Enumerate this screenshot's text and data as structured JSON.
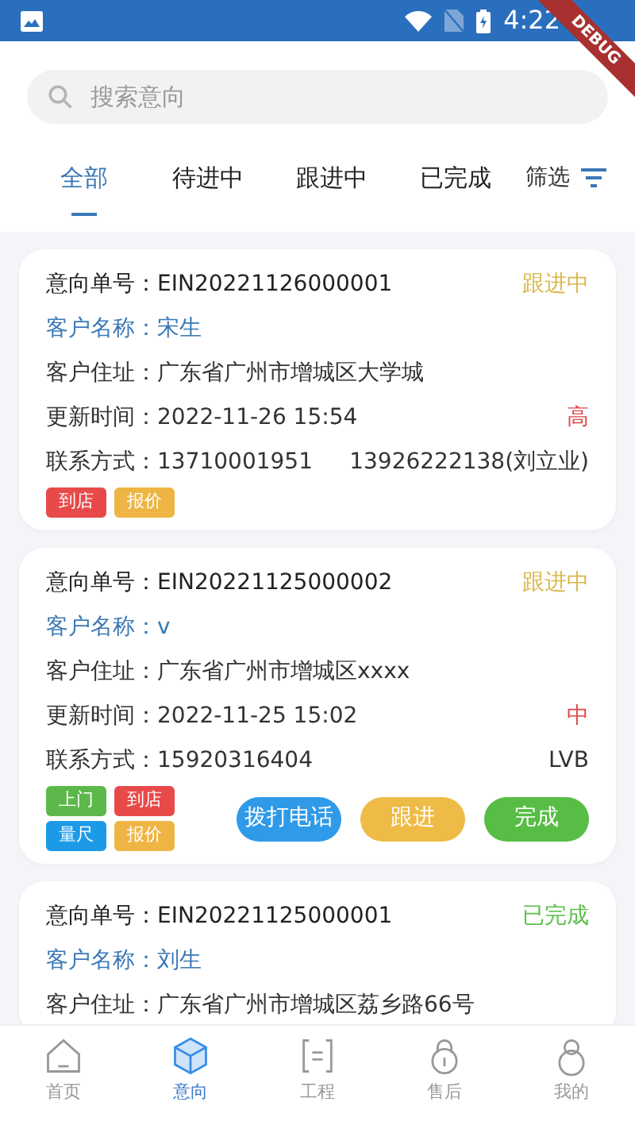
{
  "status_bar": {
    "time": "4:22"
  },
  "debug_banner": "DEBUG",
  "search": {
    "placeholder": "搜索意向"
  },
  "tabs": [
    {
      "label": "全部",
      "selected": true
    },
    {
      "label": "待进中",
      "selected": false
    },
    {
      "label": "跟进中",
      "selected": false
    },
    {
      "label": "已完成",
      "selected": false
    }
  ],
  "filter": {
    "label": "筛选"
  },
  "cards": [
    {
      "order_label": "意向单号：",
      "order_no": "EIN20221126000001",
      "status": {
        "text": "跟进中",
        "color": "#d9b94e"
      },
      "name_label": "客户名称：",
      "name": "宋生",
      "address_label": "客户住址：",
      "address": "广东省广州市增城区大学城",
      "time_label": "更新时间：",
      "time": "2022-11-26 15:54",
      "priority": {
        "text": "高",
        "color": "#e04848"
      },
      "contact_label": "联系方式：",
      "phone": "13710001951",
      "contact_2": "13926222138(刘立业)",
      "tags": [
        {
          "text": "到店",
          "color": "#e84a4a"
        },
        {
          "text": "报价",
          "color": "#efb544"
        }
      ]
    },
    {
      "order_label": "意向单号：",
      "order_no": "EIN20221125000002",
      "status": {
        "text": "跟进中",
        "color": "#d9b94e"
      },
      "name_label": "客户名称：",
      "name": "v",
      "address_label": "客户住址：",
      "address": "广东省广州市增城区xxxx",
      "time_label": "更新时间：",
      "time": "2022-11-25 15:02",
      "priority": {
        "text": "中",
        "color": "#e04848"
      },
      "contact_label": "联系方式：",
      "phone": "15920316404",
      "contact_2": "LVB",
      "tags": [
        {
          "text": "上门",
          "color": "#5cb84a"
        },
        {
          "text": "到店",
          "color": "#e84a4a"
        },
        {
          "text": "量尺",
          "color": "#1c9ae8"
        },
        {
          "text": "报价",
          "color": "#efb544"
        }
      ],
      "actions": [
        {
          "label": "拨打电话",
          "color": "#2f9ae8"
        },
        {
          "label": "跟进",
          "color": "#efbb47"
        },
        {
          "label": "完成",
          "color": "#58bd45"
        }
      ]
    },
    {
      "order_label": "意向单号：",
      "order_no": "EIN20221125000001",
      "status": {
        "text": "已完成",
        "color": "#5cbf4a"
      },
      "name_label": "客户名称：",
      "name": "刘生",
      "address_label": "客户住址：",
      "address": "广东省广州市增城区荔乡路66号"
    }
  ],
  "bottom_nav": [
    {
      "label": "首页",
      "kind": "home",
      "selected": false
    },
    {
      "label": "意向",
      "kind": "intent",
      "selected": true
    },
    {
      "label": "工程",
      "kind": "project",
      "selected": false
    },
    {
      "label": "售后",
      "kind": "service",
      "selected": false
    },
    {
      "label": "我的",
      "kind": "me",
      "selected": false
    }
  ]
}
